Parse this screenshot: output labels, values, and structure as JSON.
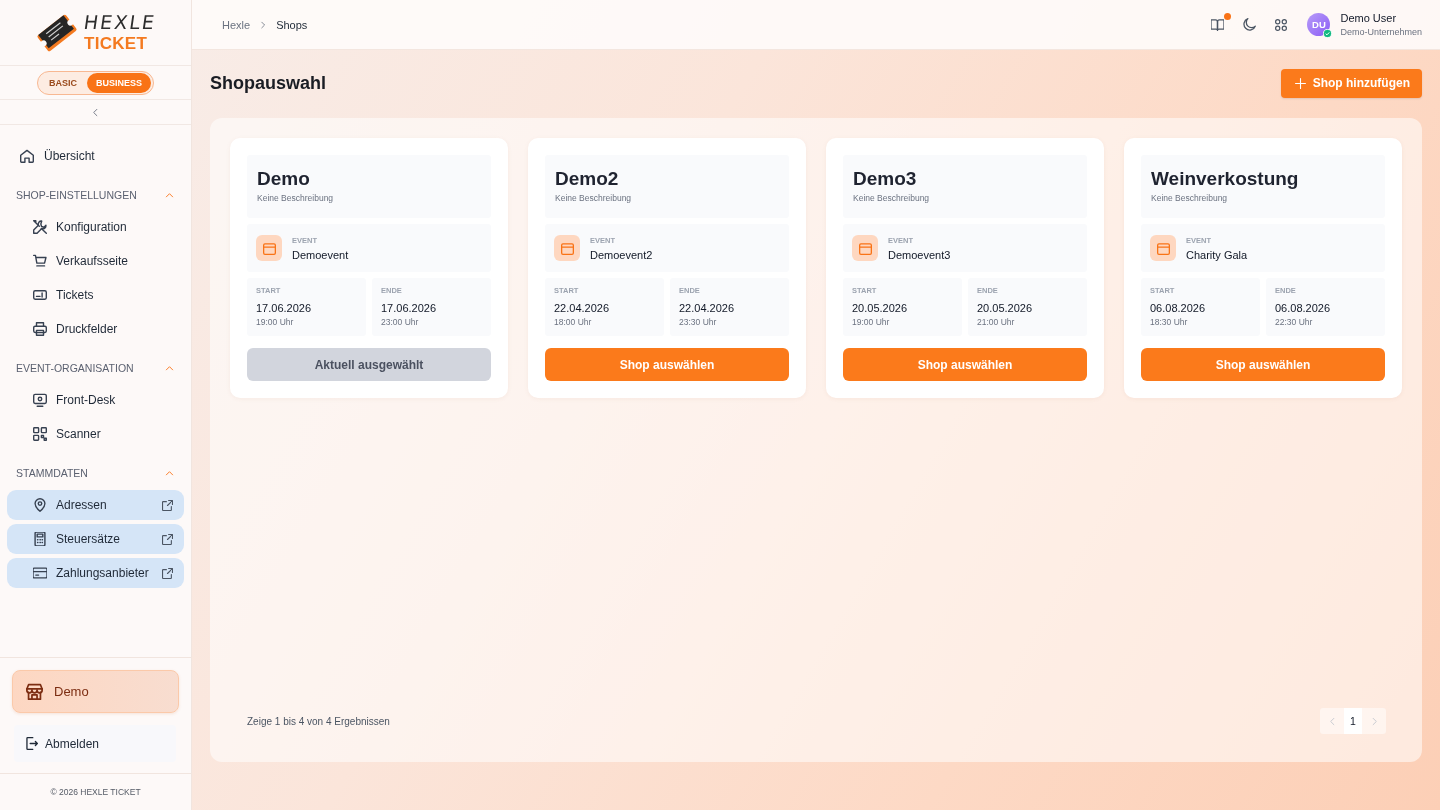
{
  "sidebar": {
    "logo": {
      "name": "HEXLE",
      "subtitle": "TICKET"
    },
    "plan_toggle": [
      {
        "label": "BASIC",
        "selected": false
      },
      {
        "label": "BUSINESS",
        "selected": true
      }
    ],
    "overview_link": "Übersicht",
    "sections": [
      {
        "title": "SHOP-EINSTELLUNGEN",
        "expanded": true,
        "items": [
          {
            "label": "Konfiguration",
            "external": false
          },
          {
            "label": "Verkaufsseite",
            "external": false
          },
          {
            "label": "Tickets",
            "external": false
          },
          {
            "label": "Druckfelder",
            "external": false
          }
        ]
      },
      {
        "title": "EVENT-ORGANISATION",
        "expanded": true,
        "items": [
          {
            "label": "Front-Desk",
            "external": false
          },
          {
            "label": "Scanner",
            "external": false
          }
        ]
      },
      {
        "title": "STAMMDATEN",
        "expanded": true,
        "items": [
          {
            "label": "Adressen",
            "external": true
          },
          {
            "label": "Steuersätze",
            "external": true
          },
          {
            "label": "Zahlungsanbieter",
            "external": true
          }
        ]
      }
    ],
    "current_shop": "Demo",
    "logout": "Abmelden",
    "footer": "© 2026 HEXLE TICKET"
  },
  "header": {
    "breadcrumb": [
      "Hexle",
      "Shops"
    ],
    "notification_dot": true,
    "user": {
      "initials": "DU",
      "name": "Demo User",
      "company": "Demo-Unternehmen",
      "verified": true
    }
  },
  "page": {
    "title": "Shopauswahl",
    "add_button": "Shop hinzufügen"
  },
  "shops": [
    {
      "name": "Demo",
      "description": "Keine Beschreibung",
      "event_label": "EVENT",
      "event": "Demoevent",
      "start_label": "START",
      "start_date": "17.06.2026",
      "start_time": "19:00 Uhr",
      "end_label": "ENDE",
      "end_date": "17.06.2026",
      "end_time": "23:00 Uhr",
      "button": "Aktuell ausgewählt",
      "selected": true
    },
    {
      "name": "Demo2",
      "description": "Keine Beschreibung",
      "event_label": "EVENT",
      "event": "Demoevent2",
      "start_label": "START",
      "start_date": "22.04.2026",
      "start_time": "18:00 Uhr",
      "end_label": "ENDE",
      "end_date": "22.04.2026",
      "end_time": "23:30 Uhr",
      "button": "Shop auswählen",
      "selected": false
    },
    {
      "name": "Demo3",
      "description": "Keine Beschreibung",
      "event_label": "EVENT",
      "event": "Demoevent3",
      "start_label": "START",
      "start_date": "20.05.2026",
      "start_time": "19:00 Uhr",
      "end_label": "ENDE",
      "end_date": "20.05.2026",
      "end_time": "21:00 Uhr",
      "button": "Shop auswählen",
      "selected": false
    },
    {
      "name": "Weinverkostung",
      "description": "Keine Beschreibung",
      "event_label": "EVENT",
      "event": "Charity Gala",
      "start_label": "START",
      "start_date": "06.08.2026",
      "start_time": "18:30 Uhr",
      "end_label": "ENDE",
      "end_date": "06.08.2026",
      "end_time": "22:30 Uhr",
      "button": "Shop auswählen",
      "selected": false
    }
  ],
  "pagination": {
    "summary": "Zeige 1 bis 4 von 4 Ergebnissen",
    "pages": [
      {
        "label": "1",
        "selected": true
      }
    ],
    "previous_disabled": true,
    "next_disabled": true
  }
}
